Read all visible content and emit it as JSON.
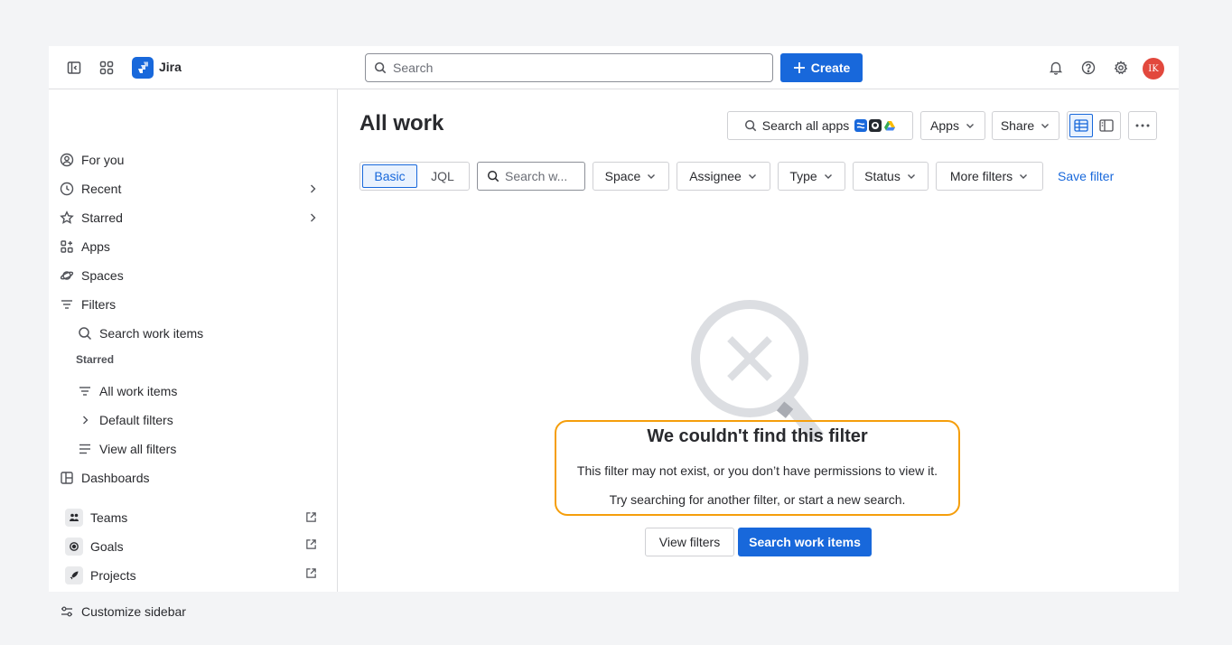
{
  "topbar": {
    "brand": "Jira",
    "search_placeholder": "Search",
    "create_label": "Create",
    "avatar_initials": "IK"
  },
  "sidebar": {
    "items": {
      "for_you": "For you",
      "recent": "Recent",
      "starred": "Starred",
      "apps": "Apps",
      "spaces": "Spaces",
      "filters": "Filters",
      "search_work_items": "Search work items",
      "starred_section": "Starred",
      "all_work_items": "All work items",
      "default_filters": "Default filters",
      "view_all_filters": "View all filters",
      "dashboards": "Dashboards",
      "teams": "Teams",
      "goals": "Goals",
      "projects": "Projects",
      "customize": "Customize sidebar"
    }
  },
  "main": {
    "title": "All work",
    "search_all_apps": "Search all apps",
    "apps_button": "Apps",
    "share_button": "Share",
    "filter_bar": {
      "basic": "Basic",
      "jql": "JQL",
      "search_placeholder": "Search w...",
      "space": "Space",
      "assignee": "Assignee",
      "type": "Type",
      "status": "Status",
      "more_filters": "More filters",
      "save_filter": "Save filter"
    },
    "empty_state": {
      "title": "We couldn't find this filter",
      "line1": "This filter may not exist, or you don’t have permissions to view it.",
      "line2": "Try searching for another filter, or start a new search.",
      "view_filters": "View filters",
      "search_work_items": "Search work items"
    }
  },
  "colors": {
    "accent": "#1868db",
    "highlight_border": "#f59e0b",
    "avatar_bg": "#e2483d"
  }
}
